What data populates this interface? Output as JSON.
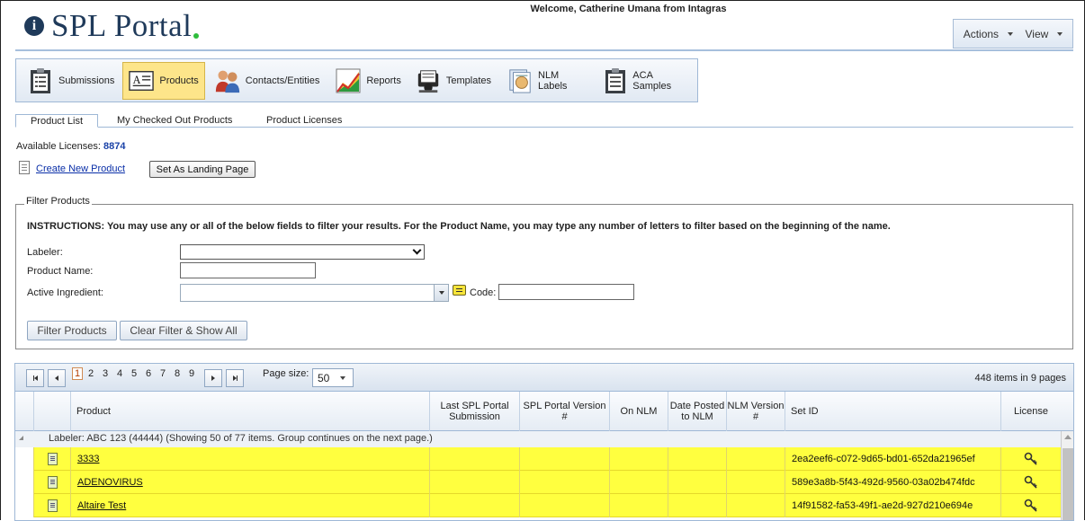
{
  "header": {
    "logo_badge": "i",
    "logo_text": "SPL Portal",
    "welcome": "Welcome, Catherine Umana from Intagras",
    "menus": [
      {
        "label": "Actions"
      },
      {
        "label": "View"
      }
    ]
  },
  "main_nav": [
    {
      "label": "Submissions",
      "icon": "clipboard-icon"
    },
    {
      "label": "Products",
      "icon": "document-a-icon",
      "active": true
    },
    {
      "label": "Contacts/Entities",
      "icon": "people-icon"
    },
    {
      "label": "Reports",
      "icon": "chart-icon"
    },
    {
      "label": "Templates",
      "icon": "rolodex-icon"
    },
    {
      "label": "NLM Labels",
      "icon": "labels-icon"
    },
    {
      "label": "ACA Samples",
      "icon": "clipboard-icon"
    }
  ],
  "sub_tabs": [
    {
      "label": "Product List",
      "active": true
    },
    {
      "label": "My Checked Out Products"
    },
    {
      "label": "Product Licenses"
    }
  ],
  "licenses": {
    "label": "Available Licenses:",
    "value": "8874"
  },
  "create_link": "Create New Product",
  "landing_button": "Set As Landing Page",
  "filter": {
    "legend": "Filter Products",
    "instructions_bold": "INSTRUCTIONS:",
    "instructions": " You may use any or all of the below fields to filter your results. For the Product Name, you may type any number of letters to filter based on the beginning of the name.",
    "labeler_label": "Labeler:",
    "labeler_value": "",
    "product_name_label": "Product Name:",
    "product_name_value": "",
    "ingredient_label": "Active Ingredient:",
    "ingredient_value": "",
    "code_label": "Code:",
    "code_value": "",
    "filter_button": "Filter Products",
    "clear_button": "Clear Filter & Show All"
  },
  "pager": {
    "pages": [
      "1",
      "2",
      "3",
      "4",
      "5",
      "6",
      "7",
      "8",
      "9"
    ],
    "current": "1",
    "page_size_label": "Page size:",
    "page_size": "50",
    "items_info": "448 items in 9 pages"
  },
  "columns": [
    "Product",
    "Last SPL Portal Submission",
    "SPL Portal Version #",
    "On NLM",
    "Date Posted to NLM",
    "NLM Version #",
    "Set ID",
    "License"
  ],
  "group_text": "Labeler: ABC 123 (44444) (Showing 50 of 77 items. Group continues on the next page.)",
  "rows": [
    {
      "product": "3333",
      "set_id": "2ea2eef6-c072-9d65-bd01-652da21965ef"
    },
    {
      "product": "ADENOVIRUS",
      "set_id": "589e3a8b-5f43-492d-9560-03a02b474fdc"
    },
    {
      "product": "Altaire Test",
      "set_id": "14f91582-fa53-49f1-ae2d-927d210e694e"
    }
  ]
}
